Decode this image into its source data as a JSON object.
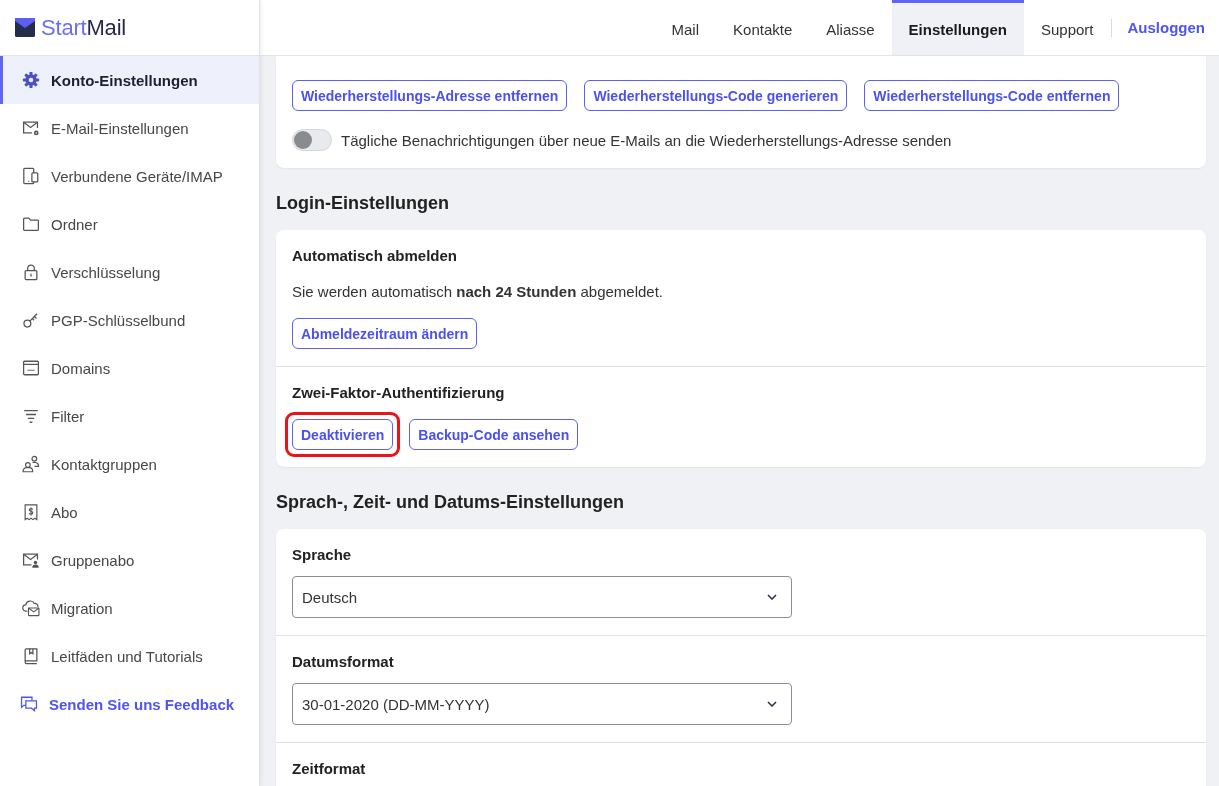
{
  "logo": {
    "parts": [
      "Start",
      "Mail"
    ]
  },
  "sidebar": {
    "items": [
      {
        "label": "Konto-Einstellungen",
        "selected": true
      },
      {
        "label": "E-Mail-Einstellungen",
        "selected": false
      },
      {
        "label": "Verbundene Geräte/IMAP",
        "selected": false
      },
      {
        "label": "Ordner",
        "selected": false
      },
      {
        "label": "Verschlüsselung",
        "selected": false
      },
      {
        "label": "PGP-Schlüsselbund",
        "selected": false
      },
      {
        "label": "Domains",
        "selected": false
      },
      {
        "label": "Filter",
        "selected": false
      },
      {
        "label": "Kontaktgruppen",
        "selected": false
      },
      {
        "label": "Abo",
        "selected": false
      },
      {
        "label": "Gruppenabo",
        "selected": false
      },
      {
        "label": "Migration",
        "selected": false
      },
      {
        "label": "Leitfäden und Tutorials",
        "selected": false
      }
    ],
    "feedback_link": "Senden Sie uns Feedback"
  },
  "nav": {
    "items": [
      {
        "label": "Mail",
        "selected": false
      },
      {
        "label": "Kontakte",
        "selected": false
      },
      {
        "label": "Aliasse",
        "selected": false
      },
      {
        "label": "Einstellungen",
        "selected": true
      },
      {
        "label": "Support",
        "selected": false
      }
    ],
    "logout": "Ausloggen"
  },
  "recovery_card": {
    "buttons": [
      "Wiederherstellungs-Adresse entfernen",
      "Wiederherstellungs-Code generieren",
      "Wiederherstellungs-Code entfernen"
    ],
    "toggle": {
      "label": "Tägliche Benachrichtigungen über neue E-Mails an die Wiederherstellungs-Adresse senden",
      "on": false
    }
  },
  "sections": [
    {
      "title": "Login-Einstellungen",
      "blocks": [
        {
          "title": "Automatisch abmelden",
          "text": "Sie werden automatisch **nach 24 Stunden** abgemeldet.",
          "buttons": [
            {
              "label": "Abmeldezeitraum ändern",
              "highlighted": false
            }
          ]
        },
        {
          "title": "Zwei-Faktor-Authentifizierung",
          "buttons": [
            {
              "label": "Deaktivieren",
              "highlighted": true
            },
            {
              "label": "Backup-Code ansehen",
              "highlighted": false
            }
          ]
        }
      ]
    },
    {
      "title": "Sprach-, Zeit- und Datums-Einstellungen",
      "blocks": [
        {
          "title": "Sprache",
          "value": "Deutsch"
        },
        {
          "title": "Datumsformat",
          "value": "30-01-2020 (DD-MM-YYYY)"
        },
        {
          "title": "Zeitformat"
        }
      ]
    }
  ]
}
